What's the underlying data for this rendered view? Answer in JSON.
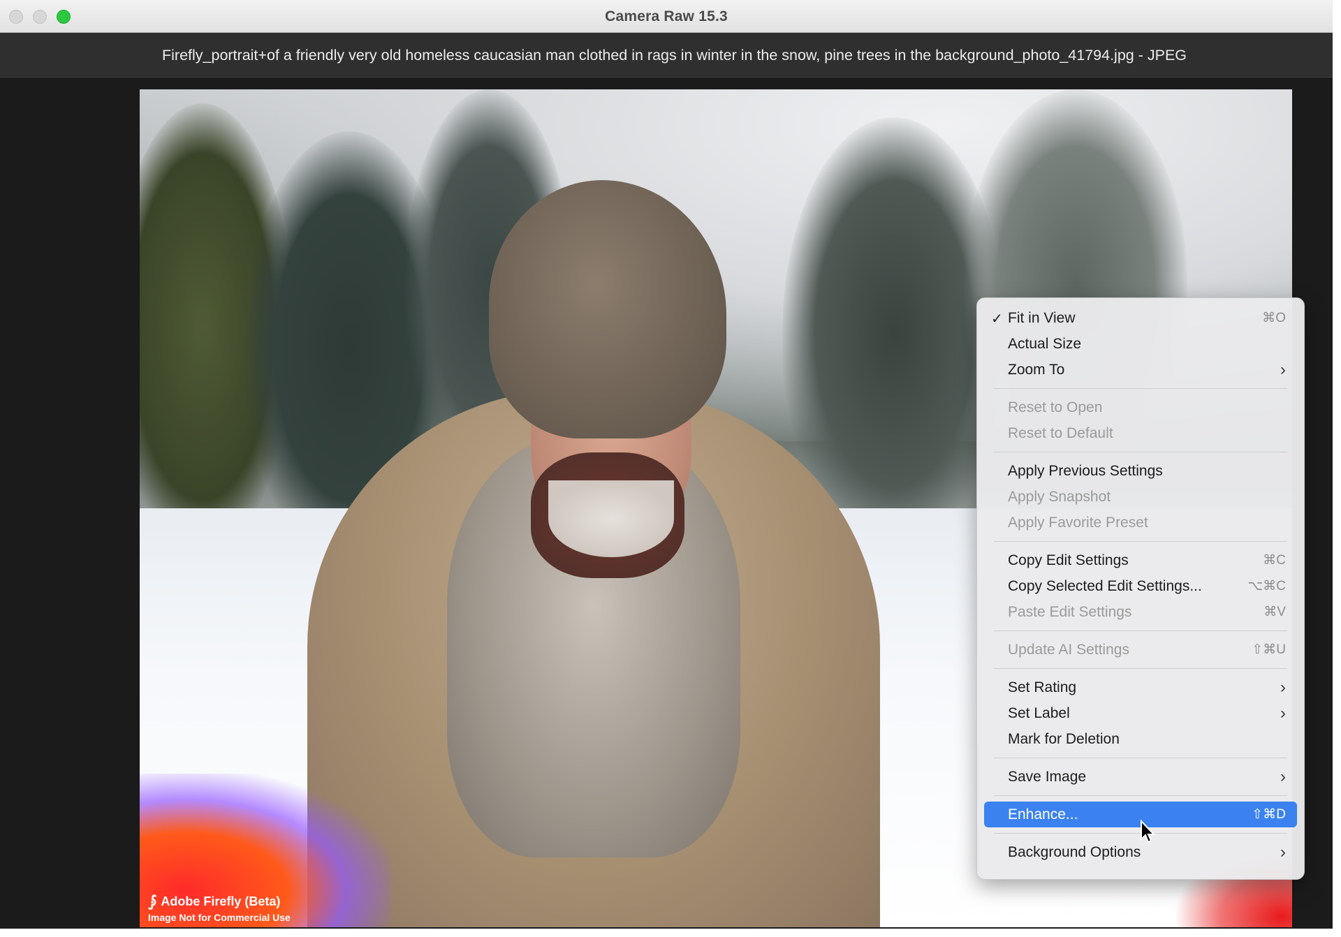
{
  "window": {
    "title": "Camera Raw 15.3",
    "filename": "Firefly_portrait+of a friendly very old homeless caucasian man clothed in rags in winter in the snow, pine trees in the background_photo_41794.jpg  -  JPEG"
  },
  "watermark": {
    "brand": "Adobe Firefly (Beta)",
    "note": "Image Not for Commercial Use"
  },
  "colors": {
    "accent": "#3b82f0",
    "maximize": "#2bc840"
  },
  "menu": {
    "items": [
      {
        "label": "Fit in View",
        "shortcut": "⌘O",
        "checked": true
      },
      {
        "label": "Actual Size"
      },
      {
        "label": "Zoom To",
        "submenu": true
      },
      {
        "label": "Reset to Open",
        "disabled": true
      },
      {
        "label": "Reset to Default",
        "disabled": true
      },
      {
        "label": "Apply Previous Settings"
      },
      {
        "label": "Apply Snapshot",
        "disabled": true
      },
      {
        "label": "Apply Favorite Preset",
        "disabled": true
      },
      {
        "label": "Copy Edit Settings",
        "shortcut": "⌘C"
      },
      {
        "label": "Copy Selected Edit Settings...",
        "shortcut": "⌥⌘C"
      },
      {
        "label": "Paste Edit Settings",
        "shortcut": "⌘V",
        "disabled": true
      },
      {
        "label": "Update AI Settings",
        "shortcut": "⇧⌘U",
        "disabled": true
      },
      {
        "label": "Set Rating",
        "submenu": true
      },
      {
        "label": "Set Label",
        "submenu": true
      },
      {
        "label": "Mark for Deletion"
      },
      {
        "label": "Save Image",
        "submenu": true
      },
      {
        "label": "Enhance...",
        "shortcut": "⇧⌘D",
        "highlighted": true
      },
      {
        "label": "Background Options",
        "submenu": true
      }
    ]
  }
}
